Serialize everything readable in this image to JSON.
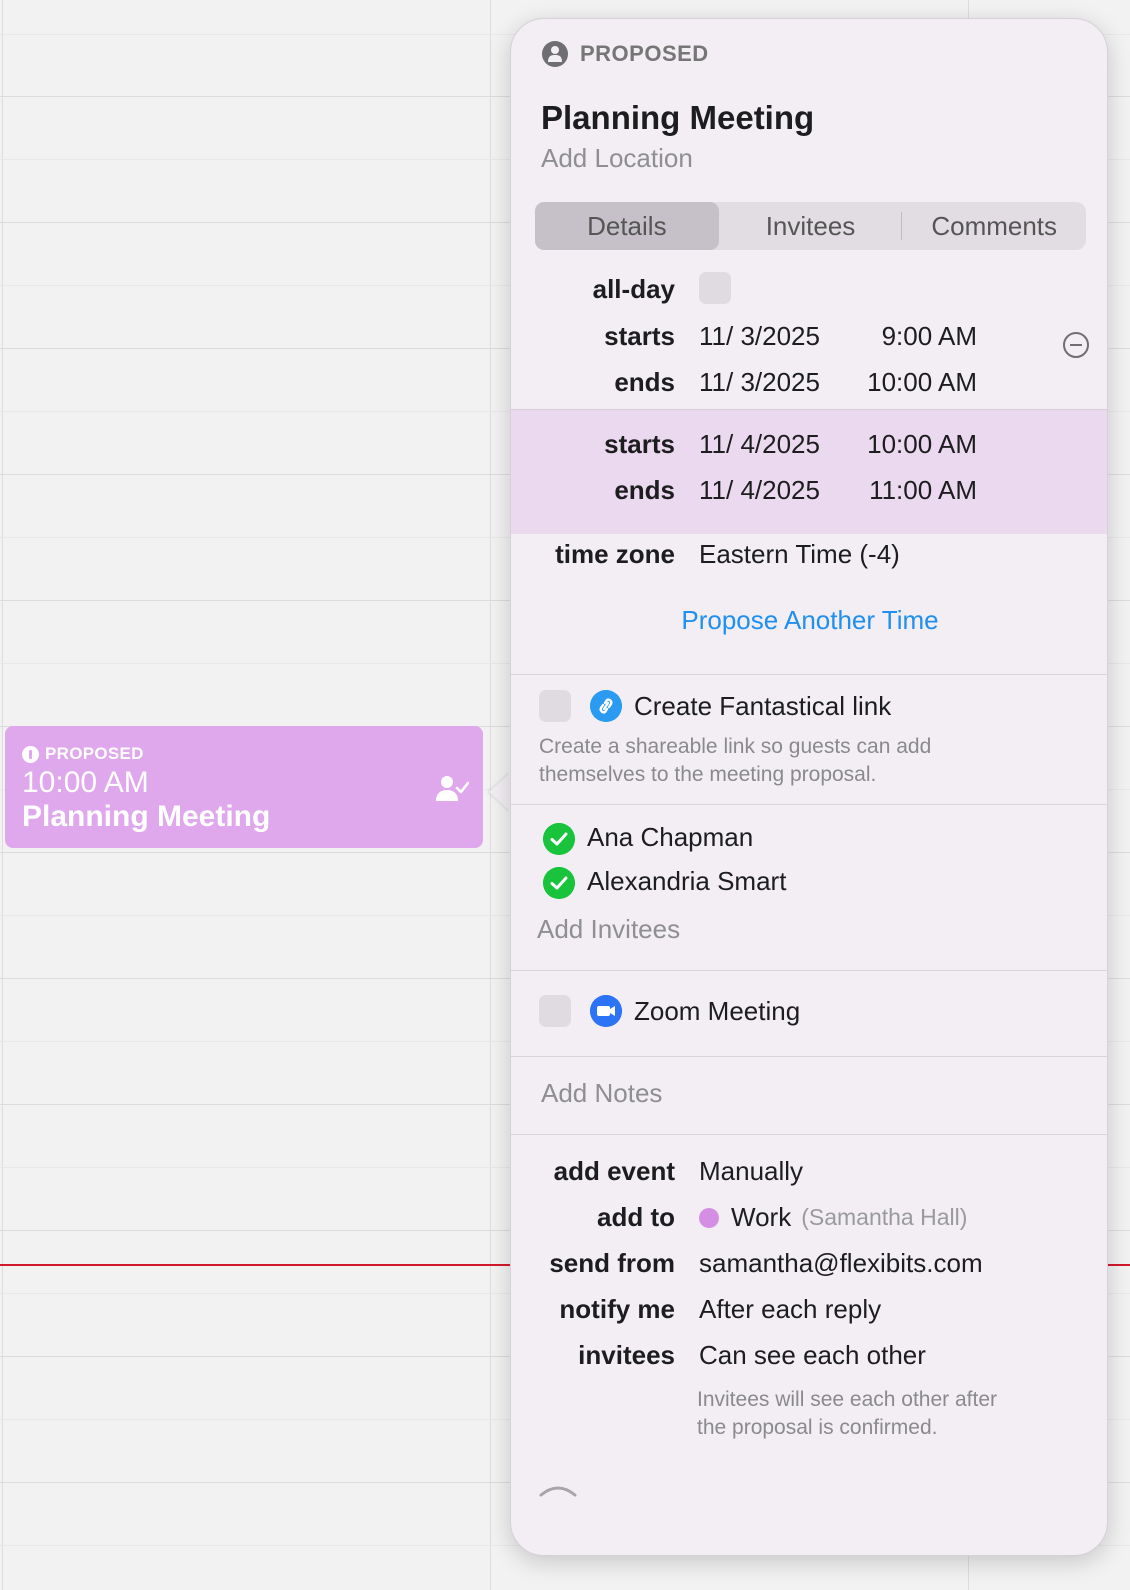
{
  "event_block": {
    "status": "PROPOSED",
    "time": "10:00 AM",
    "title": "Planning Meeting",
    "color": "#dfa7ec"
  },
  "popover": {
    "status": "PROPOSED",
    "title": "Planning Meeting",
    "location_placeholder": "Add Location",
    "tabs": [
      {
        "label": "Details",
        "active": true
      },
      {
        "label": "Invitees",
        "active": false
      },
      {
        "label": "Comments",
        "active": false
      }
    ],
    "details": {
      "all_day_label": "all-day",
      "starts_label": "starts",
      "ends_label": "ends",
      "time_option_1": {
        "start_date": "11/  3/2025",
        "start_time": "9:00 AM",
        "end_date": "11/  3/2025",
        "end_time": "10:00 AM"
      },
      "time_option_2": {
        "start_date": "11/  4/2025",
        "start_time": "10:00 AM",
        "end_date": "11/  4/2025",
        "end_time": "11:00 AM"
      },
      "time_zone_label": "time zone",
      "time_zone_value": "Eastern Time (-4)",
      "propose_another_time": "Propose Another Time"
    },
    "fantastical_link": {
      "label": "Create Fantastical link",
      "description_line1": "Create a shareable link so guests can add",
      "description_line2": "themselves to the meeting proposal."
    },
    "invitees": [
      {
        "name": "Ana Chapman"
      },
      {
        "name": "Alexandria Smart"
      }
    ],
    "add_invitees_placeholder": "Add Invitees",
    "zoom": {
      "label": "Zoom Meeting"
    },
    "notes_placeholder": "Add Notes",
    "settings": {
      "add_event_label": "add event",
      "add_event_value": "Manually",
      "add_to_label": "add to",
      "add_to_calendar": "Work",
      "add_to_account": "(Samantha Hall)",
      "send_from_label": "send from",
      "send_from_value": "samantha@flexibits.com",
      "notify_me_label": "notify me",
      "notify_me_value": "After each reply",
      "invitees_label": "invitees",
      "invitees_value": "Can see each other",
      "invitees_note_line1": "Invitees will see each other after",
      "invitees_note_line2": "the proposal is confirmed."
    }
  },
  "colors": {
    "accent_link": "#1f8ff0",
    "accepted": "#19c33b",
    "now_line": "#d11a2a",
    "work_calendar": "#d48fe5"
  }
}
